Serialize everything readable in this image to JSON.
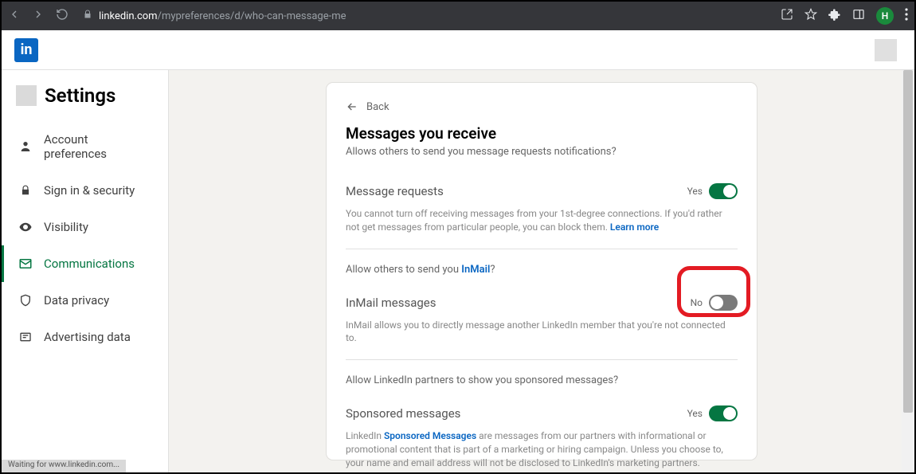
{
  "browser": {
    "url_domain": "linkedin.com",
    "url_path": "/mypreferences/d/who-can-message-me",
    "avatar_letter": "H",
    "status_text": "Waiting for www.linkedin.com..."
  },
  "logo_text": "in",
  "sidebar": {
    "title": "Settings",
    "items": [
      {
        "label": "Account preferences",
        "icon": "user"
      },
      {
        "label": "Sign in & security",
        "icon": "lock"
      },
      {
        "label": "Visibility",
        "icon": "eye"
      },
      {
        "label": "Communications",
        "icon": "mail",
        "active": true
      },
      {
        "label": "Data privacy",
        "icon": "shield"
      },
      {
        "label": "Advertising data",
        "icon": "ad"
      }
    ]
  },
  "card": {
    "back_label": "Back",
    "title": "Messages you receive",
    "subtitle": "Allows others to send you message requests notifications?",
    "section1": {
      "heading": "Message requests",
      "state": "Yes",
      "on": true,
      "helper_pre": "You cannot turn off receiving messages from your 1st-degree connections. If you'd rather not get messages from particular people, you can block them. ",
      "helper_link": "Learn more"
    },
    "section2": {
      "intro_pre": "Allow others to send you ",
      "intro_link": "InMail",
      "intro_post": "?",
      "heading": "InMail messages",
      "state": "No",
      "on": false,
      "helper": "InMail allows you to directly message another LinkedIn member that you're not connected to."
    },
    "section3": {
      "intro": "Allow LinkedIn partners to show you sponsored messages?",
      "heading": "Sponsored messages",
      "state": "Yes",
      "on": true,
      "helper_pre": "LinkedIn ",
      "helper_link": "Sponsored Messages",
      "helper_post": " are messages from our partners with informational or promotional content that is part of a marketing or hiring campaign. Unless you choose to, your name and email address will not be disclosed to LinkedIn's marketing partners."
    }
  }
}
